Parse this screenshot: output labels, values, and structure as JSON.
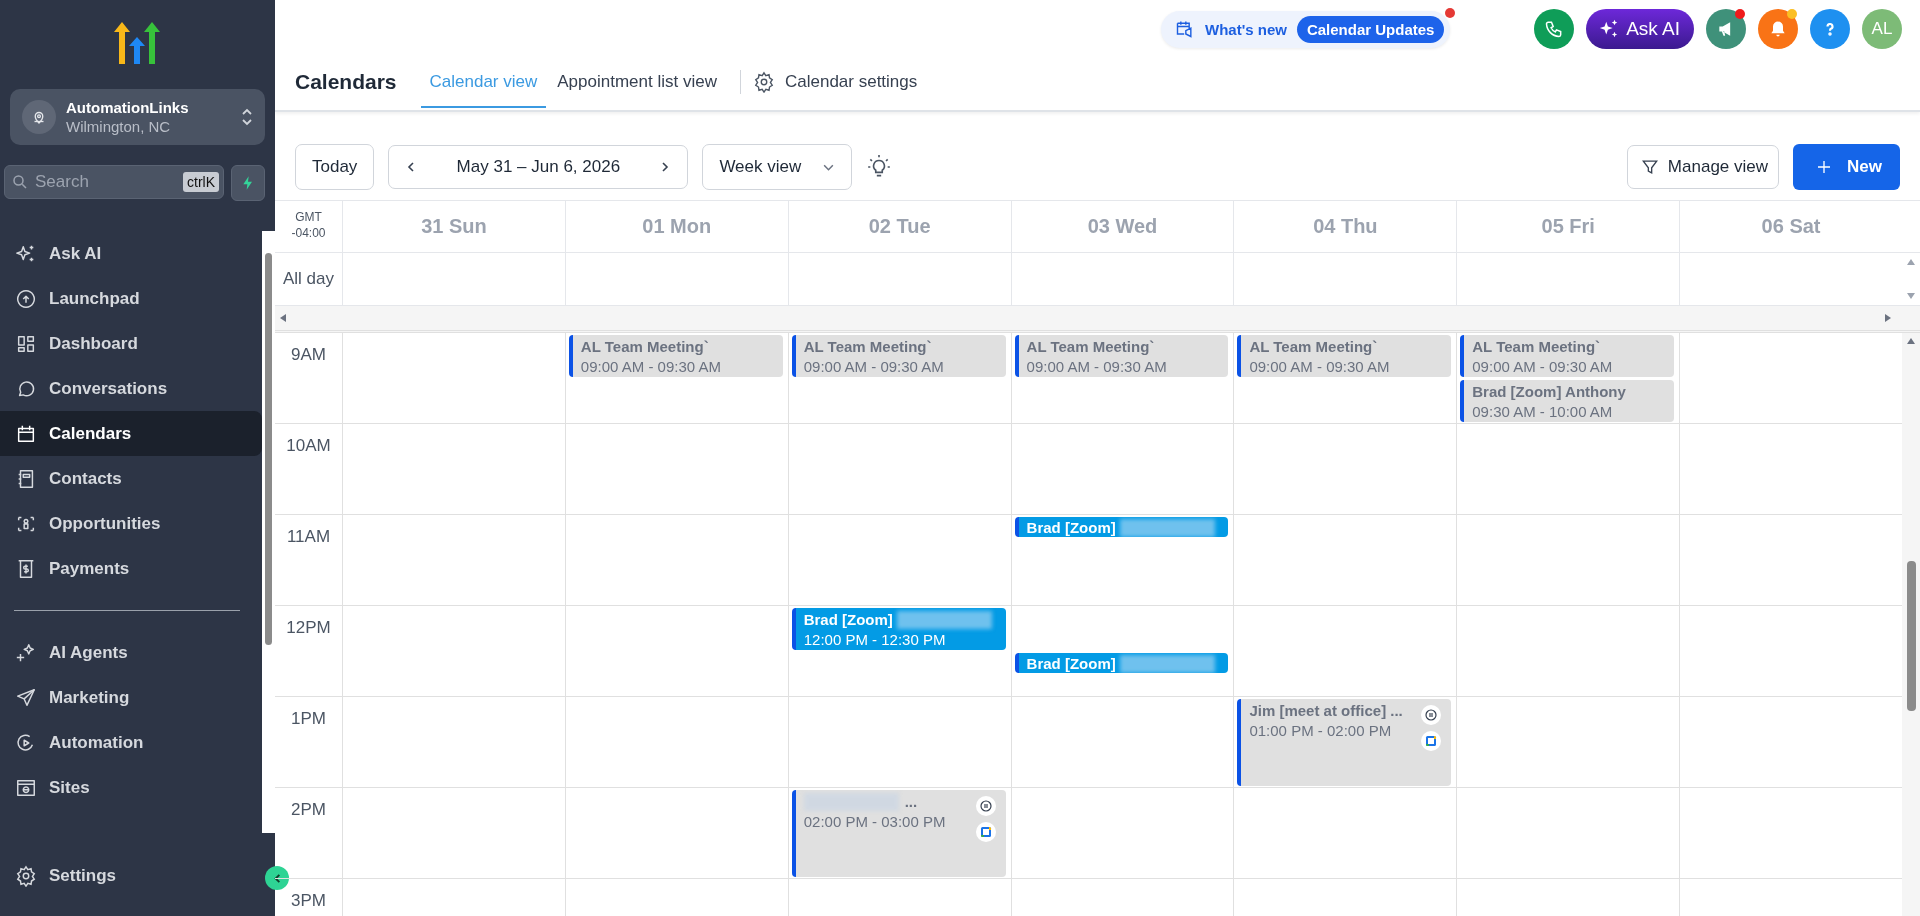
{
  "sidebar": {
    "account": {
      "name": "AutomationLinks",
      "location": "Wilmington, NC"
    },
    "search": {
      "placeholder": "Search",
      "shortcut": "ctrlK"
    },
    "nav": [
      {
        "label": "Ask AI",
        "selected": false
      },
      {
        "label": "Launchpad",
        "selected": false
      },
      {
        "label": "Dashboard",
        "selected": false
      },
      {
        "label": "Conversations",
        "selected": false
      },
      {
        "label": "Calendars",
        "selected": true
      },
      {
        "label": "Contacts",
        "selected": false
      },
      {
        "label": "Opportunities",
        "selected": false
      },
      {
        "label": "Payments",
        "selected": false
      }
    ],
    "nav_more": [
      {
        "label": "AI Agents",
        "selected": false
      },
      {
        "label": "Marketing",
        "selected": false
      },
      {
        "label": "Automation",
        "selected": false
      },
      {
        "label": "Sites",
        "selected": false
      }
    ],
    "settings": "Settings"
  },
  "topbar": {
    "whats_new": "What's new",
    "updates_badge": "Calendar Updates",
    "ask_ai": "Ask AI",
    "avatar": "AL"
  },
  "header": {
    "title": "Calendars",
    "tabs": [
      {
        "label": "Calendar view",
        "selected": true
      },
      {
        "label": "Appointment list view",
        "selected": false
      }
    ],
    "settings_link": "Calendar settings"
  },
  "toolbar": {
    "today": "Today",
    "range": "May 31 – Jun 6, 2026",
    "view": "Week view",
    "manage": "Manage view",
    "new": "New"
  },
  "calendar": {
    "timezone": "GMT -04:00",
    "all_day": "All day",
    "days": [
      "31 Sun",
      "01 Mon",
      "02 Tue",
      "03 Wed",
      "04 Thu",
      "05 Fri",
      "06 Sat"
    ],
    "hours": [
      {
        "label": "9AM",
        "cells": [
          {},
          {
            "on_the_hour": [
              {
                "kind": "half",
                "title": "AL Team Meeting`",
                "time": "09:00 AM - 09:30 AM",
                "color": "#e0e0e0",
                "blurred": false,
                "synced": false
              }
            ]
          },
          {
            "on_the_hour": [
              {
                "kind": "half",
                "title": "AL Team Meeting`",
                "time": "09:00 AM - 09:30 AM",
                "color": "#e0e0e0",
                "blurred": false,
                "synced": false
              }
            ]
          },
          {
            "on_the_hour": [
              {
                "kind": "half",
                "title": "AL Team Meeting`",
                "time": "09:00 AM - 09:30 AM",
                "color": "#e0e0e0",
                "blurred": false,
                "synced": false
              }
            ]
          },
          {
            "on_the_hour": [
              {
                "kind": "half",
                "title": "AL Team Meeting`",
                "time": "09:00 AM - 09:30 AM",
                "color": "#e0e0e0",
                "blurred": false,
                "synced": false
              }
            ]
          },
          {
            "on_the_hour": [
              {
                "kind": "half",
                "title": "AL Team Meeting`",
                "time": "09:00 AM - 09:30 AM",
                "color": "#e0e0e0",
                "blurred": false,
                "synced": false
              }
            ],
            "half_past": [
              {
                "kind": "half",
                "title": "Brad [Zoom] Anthony",
                "time": "09:30 AM - 10:00 AM",
                "color": "#e0e0e0",
                "blurred": false,
                "synced": false
              }
            ]
          },
          {}
        ]
      },
      {
        "label": "10AM",
        "cells": [
          {},
          {},
          {},
          {},
          {},
          {},
          {}
        ]
      },
      {
        "label": "11AM",
        "cells": [
          {},
          {},
          {},
          {
            "on_the_hour": [
              {
                "kind": "brief",
                "title": "Brad [Zoom]",
                "color": "#039be5",
                "blurred": true,
                "synced": false
              }
            ]
          },
          {},
          {},
          {}
        ]
      },
      {
        "label": "12PM",
        "cells": [
          {},
          {},
          {
            "on_the_hour": [
              {
                "kind": "half",
                "title": "Brad [Zoom]",
                "time": "12:00 PM - 12:30 PM",
                "color": "#039be5",
                "blurred": true,
                "synced": false
              }
            ]
          },
          {
            "half_past": [
              {
                "kind": "brief",
                "title": "Brad [Zoom]",
                "color": "#039be5",
                "blurred": true,
                "synced": false
              }
            ]
          },
          {},
          {},
          {}
        ]
      },
      {
        "label": "1PM",
        "cells": [
          {},
          {},
          {},
          {},
          {
            "on_the_hour": [
              {
                "kind": "hour",
                "title": "Jim [meet at office] ...",
                "time": "01:00 PM - 02:00 PM",
                "color": "#e0e0e0",
                "blurred": false,
                "synced": true
              }
            ]
          },
          {},
          {}
        ]
      },
      {
        "label": "2PM",
        "cells": [
          {},
          {},
          {
            "on_the_hour": [
              {
                "kind": "hour",
                "title": "...",
                "time": "02:00 PM - 03:00 PM",
                "color": "#e0e0e0",
                "blurred": true,
                "synced": true
              }
            ]
          },
          {},
          {},
          {},
          {}
        ]
      },
      {
        "label": "3PM",
        "cells": [
          {},
          {},
          {},
          {},
          {},
          {},
          {}
        ]
      }
    ]
  }
}
